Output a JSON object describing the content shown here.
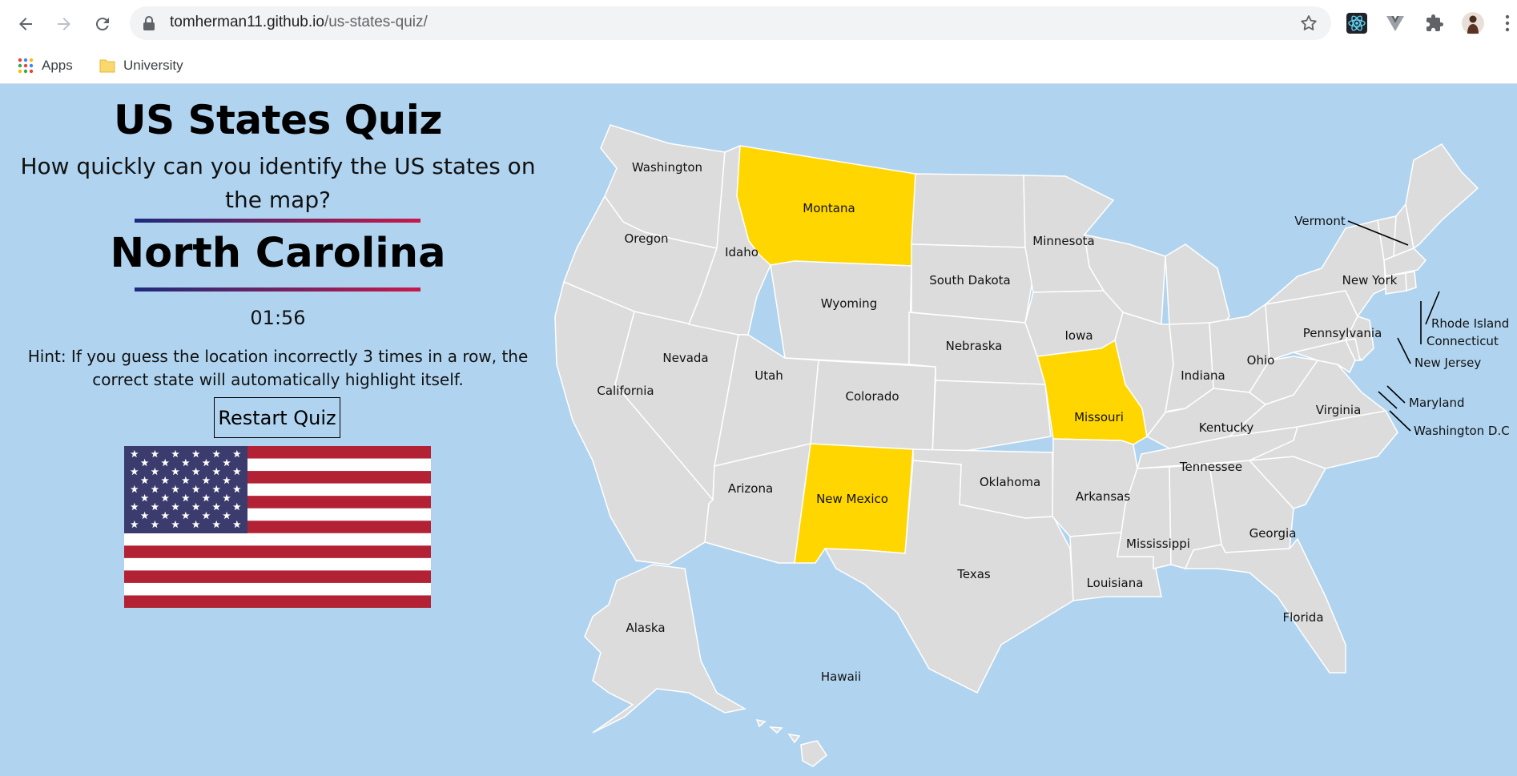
{
  "browser": {
    "url_host": "tomherman11.github.io",
    "url_path": "/us-states-quiz/",
    "bookmarks": [
      {
        "label": "Apps",
        "icon": "apps-grid-icon"
      },
      {
        "label": "University",
        "icon": "folder-icon"
      }
    ]
  },
  "quiz": {
    "title": "US States Quiz",
    "question": "How quickly can you identify the US states on the map?",
    "target_state": "North Carolina",
    "timer": "01:56",
    "hint": "Hint: If you guess the location incorrectly 3 times in a row, the correct state will automatically highlight itself.",
    "restart_label": "Restart Quiz"
  },
  "map": {
    "highlight_color": "#ffd600",
    "state_color": "#dcdcdc",
    "highlighted_states": [
      "Montana",
      "New Mexico",
      "Missouri"
    ],
    "labels": {
      "washington": "Washington",
      "oregon": "Oregon",
      "california": "California",
      "nevada": "Nevada",
      "idaho": "Idaho",
      "montana": "Montana",
      "wyoming": "Wyoming",
      "utah": "Utah",
      "arizona": "Arizona",
      "colorado": "Colorado",
      "new_mexico": "New Mexico",
      "south_dakota": "South Dakota",
      "nebraska": "Nebraska",
      "minnesota": "Minnesota",
      "iowa": "Iowa",
      "missouri": "Missouri",
      "oklahoma": "Oklahoma",
      "texas": "Texas",
      "arkansas": "Arkansas",
      "louisiana": "Louisiana",
      "mississippi": "Mississippi",
      "indiana": "Indiana",
      "ohio": "Ohio",
      "kentucky": "Kentucky",
      "tennessee": "Tennessee",
      "georgia": "Georgia",
      "florida": "Florida",
      "virginia": "Virginia",
      "pennsylvania": "Pennsylvania",
      "new_york": "New York",
      "vermont": "Vermont",
      "rhode_island": "Rhode Island",
      "connecticut": "Connecticut",
      "new_jersey": "New Jersey",
      "maryland": "Maryland",
      "washington_dc": "Washington D.C",
      "alaska": "Alaska",
      "hawaii": "Hawaii"
    }
  },
  "colors": {
    "page_background": "#b0d4f0",
    "flag_red": "#b22234",
    "flag_blue": "#3c3b6e"
  }
}
